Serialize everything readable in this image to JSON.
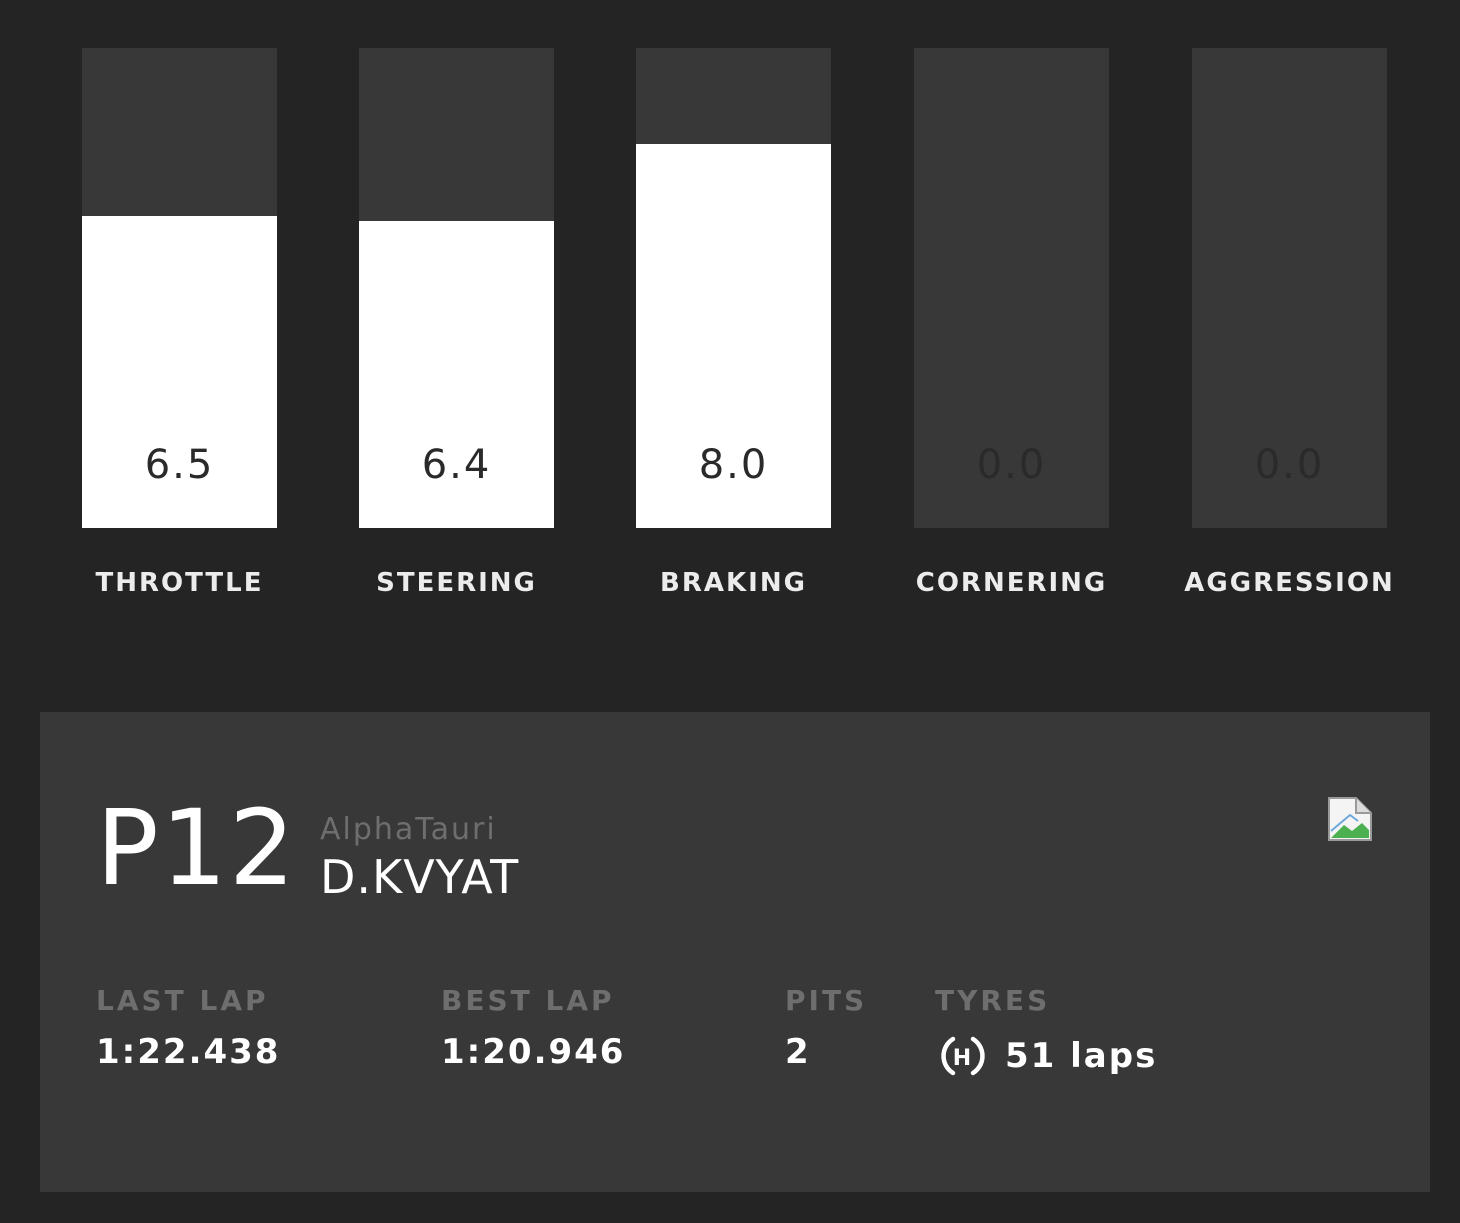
{
  "bars": [
    {
      "label": "THROTTLE",
      "value": "6.5",
      "level": 0.65
    },
    {
      "label": "STEERING",
      "value": "6.4",
      "level": 0.64
    },
    {
      "label": "BRAKING",
      "value": "8.0",
      "level": 0.8
    },
    {
      "label": "CORNERING",
      "value": "0.0",
      "level": 0.0
    },
    {
      "label": "AGGRESSION",
      "value": "0.0",
      "level": 0.0
    }
  ],
  "driver": {
    "position": "P12",
    "team": "AlphaTauri",
    "name": "D.KVYAT"
  },
  "stats": {
    "last_lap": {
      "label": "LAST LAP",
      "value": "1:22.438"
    },
    "best_lap": {
      "label": "BEST LAP",
      "value": "1:20.946"
    },
    "pits": {
      "label": "PITS",
      "value": "2"
    },
    "tyres": {
      "label": "TYRES",
      "value": "51 laps",
      "compound": "H"
    }
  },
  "icons": {
    "team_logo": "broken-image-icon",
    "tyre": "hard-tyre-icon"
  },
  "colors": {
    "background": "#242424",
    "panel": "#383838",
    "fill": "#ffffff",
    "muted_text": "#6e6e6e"
  }
}
